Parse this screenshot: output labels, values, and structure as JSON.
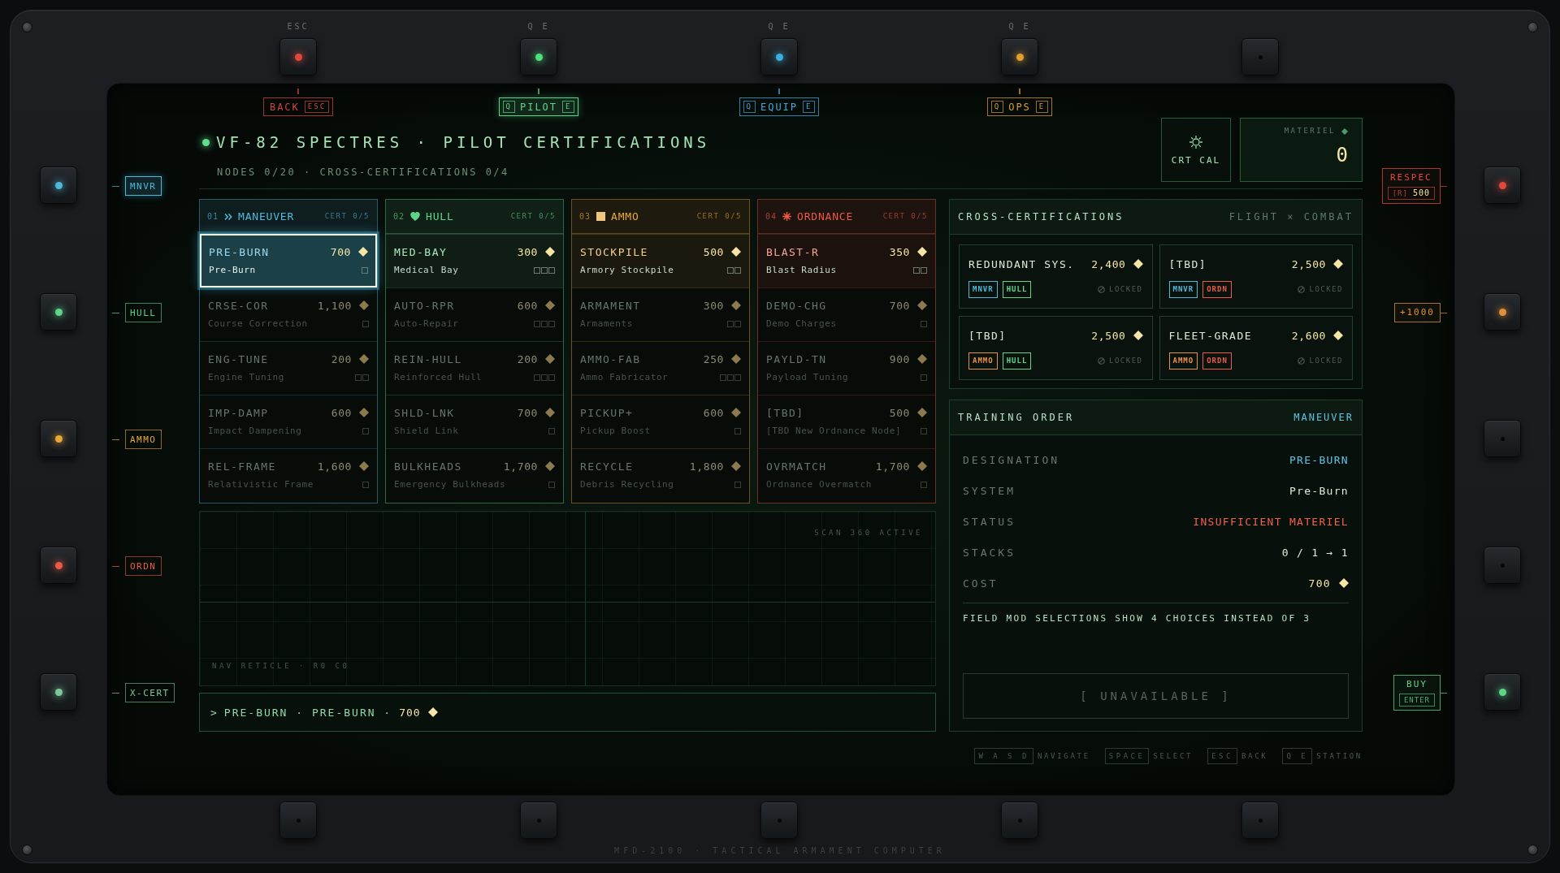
{
  "top_keys": [
    {
      "label": "ESC",
      "lit": true,
      "color": "#e0483c"
    },
    {
      "label": "Q E",
      "lit": true,
      "color": "#4ee07a"
    },
    {
      "label": "Q E",
      "lit": true,
      "color": "#3ab0e0"
    },
    {
      "label": "Q E",
      "lit": true,
      "color": "#e0a030"
    },
    {
      "lit": false
    }
  ],
  "tabs": [
    {
      "kind": "back",
      "label": "BACK",
      "key": "ESC",
      "color": "#d0463c",
      "selected": false
    },
    {
      "kind": "station",
      "label": "PILOT",
      "prev_key": "Q",
      "next_key": "E",
      "color": "#5ed489",
      "selected": true
    },
    {
      "kind": "station",
      "label": "EQUIP",
      "prev_key": "Q",
      "next_key": "E",
      "color": "#3fa8d8",
      "selected": false
    },
    {
      "kind": "station",
      "label": "OPS",
      "prev_key": "Q",
      "next_key": "E",
      "color": "#d89a30",
      "selected": false
    }
  ],
  "left_keys": [
    {
      "label": "MNVR",
      "lit": true,
      "color": "#4fb8dc",
      "selected": true
    },
    {
      "label": "HULL",
      "lit": true,
      "color": "#5fd48a",
      "selected": false
    },
    {
      "label": "AMMO",
      "lit": true,
      "color": "#e8a838",
      "selected": false
    },
    {
      "label": "ORDN",
      "lit": true,
      "color": "#ec5a48",
      "selected": false
    },
    {
      "label": "X-CERT",
      "lit": true,
      "color": "#7cc89a",
      "selected": false
    }
  ],
  "right_keys": [
    {
      "lit": true,
      "color": "#e0483c",
      "panel": {
        "title": "RESPEC",
        "key": "[R]",
        "value": "500"
      }
    },
    {
      "lit": true,
      "color": "#e0903a",
      "panel": {
        "title": "+1000"
      }
    },
    {
      "lit": false
    },
    {
      "lit": false
    },
    {
      "lit": true,
      "color": "#5ed489",
      "panel": {
        "title": "BUY",
        "key": "ENTER"
      }
    }
  ],
  "bottom_keys": [
    {
      "lit": false
    },
    {
      "lit": false
    },
    {
      "lit": false
    },
    {
      "lit": false
    },
    {
      "lit": false
    }
  ],
  "header": {
    "title": "VF-82 SPECTRES · PILOT CERTIFICATIONS",
    "subtitle": "NODES 0/20 · CROSS-CERTIFICATIONS 0/4",
    "calibrate": "CRT CAL",
    "materiel": {
      "label": "MATERIEL",
      "value": "0"
    }
  },
  "columns": [
    {
      "number": "01",
      "title": "MANEUVER",
      "cert": "CERT 0/5",
      "color": "#4fb8dc",
      "items": [
        {
          "code": "PRE-BURN",
          "cost": "700",
          "name": "Pre-Burn",
          "pips": [
            false
          ],
          "available": true,
          "selected": true
        },
        {
          "code": "CRSE-COR",
          "cost": "1,100",
          "name": "Course Correction",
          "pips": [
            false
          ],
          "available": false,
          "selected": false
        },
        {
          "code": "ENG-TUNE",
          "cost": "200",
          "name": "Engine Tuning",
          "pips": [
            false,
            false
          ],
          "available": false,
          "selected": false
        },
        {
          "code": "IMP-DAMP",
          "cost": "600",
          "name": "Impact Dampening",
          "pips": [
            false
          ],
          "available": false,
          "selected": false
        },
        {
          "code": "REL-FRAME",
          "cost": "1,600",
          "name": "Relativistic Frame",
          "pips": [
            false
          ],
          "available": false,
          "selected": false
        }
      ]
    },
    {
      "number": "02",
      "title": "HULL",
      "cert": "CERT 0/5",
      "color": "#5fd48a",
      "items": [
        {
          "code": "MED-BAY",
          "cost": "300",
          "name": "Medical Bay",
          "pips": [
            false,
            false,
            false
          ],
          "available": true,
          "selected": false
        },
        {
          "code": "AUTO-RPR",
          "cost": "600",
          "name": "Auto-Repair",
          "pips": [
            false,
            false,
            false
          ],
          "available": false,
          "selected": false
        },
        {
          "code": "REIN-HULL",
          "cost": "200",
          "name": "Reinforced Hull",
          "pips": [
            false,
            false,
            false
          ],
          "available": false,
          "selected": false
        },
        {
          "code": "SHLD-LNK",
          "cost": "700",
          "name": "Shield Link",
          "pips": [
            false
          ],
          "available": false,
          "selected": false
        },
        {
          "code": "BULKHEADS",
          "cost": "1,700",
          "name": "Emergency Bulkheads",
          "pips": [
            false
          ],
          "available": false,
          "selected": false
        }
      ]
    },
    {
      "number": "03",
      "title": "AMMO",
      "cert": "CERT 0/5",
      "color": "#e8a838",
      "items": [
        {
          "code": "STOCKPILE",
          "cost": "500",
          "name": "Armory Stockpile",
          "pips": [
            false,
            false
          ],
          "available": true,
          "selected": false
        },
        {
          "code": "ARMAMENT",
          "cost": "300",
          "name": "Armaments",
          "pips": [
            false,
            false
          ],
          "available": false,
          "selected": false
        },
        {
          "code": "AMMO-FAB",
          "cost": "250",
          "name": "Ammo Fabricator",
          "pips": [
            false,
            false,
            false
          ],
          "available": false,
          "selected": false
        },
        {
          "code": "PICKUP+",
          "cost": "600",
          "name": "Pickup Boost",
          "pips": [
            false
          ],
          "available": false,
          "selected": false
        },
        {
          "code": "RECYCLE",
          "cost": "1,800",
          "name": "Debris Recycling",
          "pips": [
            false
          ],
          "available": false,
          "selected": false
        }
      ]
    },
    {
      "number": "04",
      "title": "ORDNANCE",
      "cert": "CERT 0/5",
      "color": "#ec5a48",
      "items": [
        {
          "code": "BLAST-R",
          "cost": "350",
          "name": "Blast Radius",
          "pips": [
            false,
            false
          ],
          "available": true,
          "selected": false
        },
        {
          "code": "DEMO-CHG",
          "cost": "700",
          "name": "Demo Charges",
          "pips": [
            false
          ],
          "available": false,
          "selected": false
        },
        {
          "code": "PAYLD-TN",
          "cost": "900",
          "name": "Payload Tuning",
          "pips": [
            false
          ],
          "available": false,
          "selected": false
        },
        {
          "code": "[TBD]",
          "cost": "500",
          "name": "[TBD New Ordnance Node]",
          "pips": [
            false
          ],
          "available": false,
          "selected": false
        },
        {
          "code": "OVRMATCH",
          "cost": "1,700",
          "name": "Ordnance Overmatch",
          "pips": [
            false
          ],
          "available": false,
          "selected": false
        }
      ]
    }
  ],
  "radar": {
    "top_label": "SCAN 360 ACTIVE",
    "bottom_label": "NAV RETICLE · R0 C0"
  },
  "command": {
    "prompt": ">",
    "text": "PRE-BURN · PRE-BURN ·",
    "cost": "700"
  },
  "cross_certifications": {
    "title": "CROSS-CERTIFICATIONS",
    "subtitle": "FLIGHT × COMBAT",
    "cards": [
      {
        "name": "REDUNDANT SYS.",
        "cost": "2,400",
        "tags": [
          {
            "label": "MNVR",
            "color": "#4fb8dc"
          },
          {
            "label": "HULL",
            "color": "#5fd48a"
          }
        ],
        "status": "LOCKED"
      },
      {
        "name": "[TBD]",
        "cost": "2,500",
        "tags": [
          {
            "label": "MNVR",
            "color": "#4fb8dc"
          },
          {
            "label": "ORDN",
            "color": "#ec5a48"
          }
        ],
        "status": "LOCKED"
      },
      {
        "name": "[TBD]",
        "cost": "2,500",
        "tags": [
          {
            "label": "AMMO",
            "color": "#e8904a"
          },
          {
            "label": "HULL",
            "color": "#5fd48a"
          }
        ],
        "status": "LOCKED"
      },
      {
        "name": "FLEET-GRADE",
        "cost": "2,600",
        "tags": [
          {
            "label": "AMMO",
            "color": "#e8904a"
          },
          {
            "label": "ORDN",
            "color": "#ec5a48"
          }
        ],
        "status": "LOCKED"
      }
    ]
  },
  "training_order": {
    "title": "TRAINING ORDER",
    "category": "MANEUVER",
    "fields": [
      {
        "label": "DESIGNATION",
        "value": "PRE-BURN",
        "kind": "text",
        "color": "#5cc4e4"
      },
      {
        "label": "SYSTEM",
        "value": "Pre-Burn",
        "kind": "text",
        "color": "#dcecdc"
      },
      {
        "label": "STATUS",
        "value": "INSUFFICIENT MATERIEL",
        "kind": "text",
        "color": "#f0604a"
      },
      {
        "label": "STACKS",
        "value": "0 / 1 → 1",
        "kind": "text",
        "color": "#dcecdc"
      },
      {
        "label": "COST",
        "value": "700",
        "kind": "cost",
        "color": "#f5e6a8"
      }
    ],
    "description": "FIELD MOD SELECTIONS SHOW 4 CHOICES INSTEAD OF 3",
    "action": {
      "label": "[ UNAVAILABLE ]",
      "disabled": true
    }
  },
  "key_hints": [
    {
      "keys": "W A S D",
      "action": "NAVIGATE"
    },
    {
      "keys": "SPACE",
      "action": "SELECT"
    },
    {
      "keys": "ESC",
      "action": "BACK"
    },
    {
      "keys": "Q E",
      "action": "STATION"
    }
  ],
  "footer": "MFD-2100 · TACTICAL ARMAMENT COMPUTER"
}
